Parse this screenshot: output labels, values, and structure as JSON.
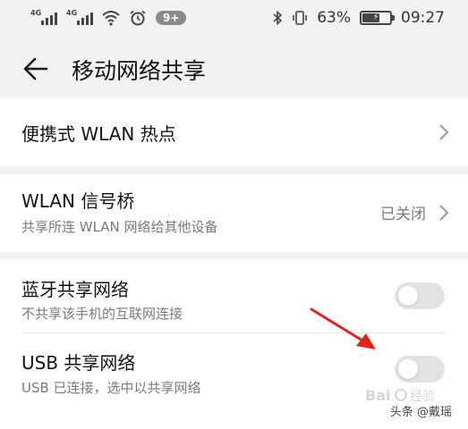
{
  "status_bar": {
    "sim1_tag": "4G",
    "sim2_tag": "4G",
    "notification_count": "9+",
    "battery_percent": "63%",
    "battery_level": 63,
    "time": "09:27",
    "icons": [
      "signal-icon",
      "wifi-icon",
      "alarm-icon",
      "bluetooth-icon",
      "vibrate-icon",
      "battery-icon"
    ]
  },
  "header": {
    "title": "移动网络共享",
    "back_icon": "arrow-left-icon"
  },
  "items": [
    {
      "title": "便携式 WLAN 热点",
      "subtitle": "",
      "status": "",
      "control": "chevron"
    },
    {
      "title": "WLAN 信号桥",
      "subtitle": "共享所连 WLAN 网络给其他设备",
      "status": "已关闭",
      "control": "chevron"
    },
    {
      "title": "蓝牙共享网络",
      "subtitle": "不共享该手机的互联网连接",
      "status": "",
      "control": "toggle",
      "toggle_on": false
    },
    {
      "title": "USB 共享网络",
      "subtitle": "USB 已连接，选中以共享网络",
      "status": "",
      "control": "toggle",
      "toggle_on": false
    }
  ],
  "colors": {
    "background": "#f2f2f2",
    "card": "#ffffff",
    "toggle_off": "#e3e3e3",
    "annotation_arrow": "#e0261b",
    "secondary_text": "#7a7a7a"
  },
  "watermark": {
    "logo_text": "Baidu经验",
    "credit": "头条 @戴瑶"
  }
}
